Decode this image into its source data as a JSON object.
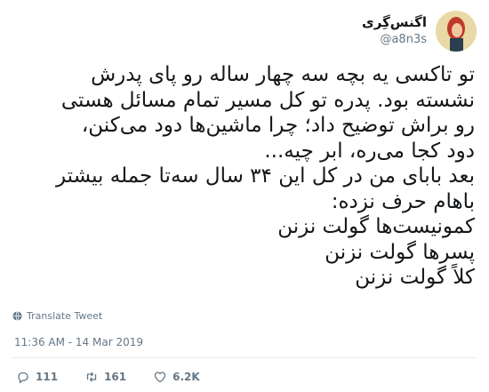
{
  "author": {
    "display_name": "اگنس‌گِری",
    "handle": "@a8n3s"
  },
  "tweet": {
    "lines": [
      "تو تاکسی یه بچه سه چهار ساله رو پای پدرش",
      "نشسته بود. پدره تو کل مسیر تمام مسائل هستی",
      "رو براش توضیح داد؛ چرا ماشین‌ها دود می‌کنن،",
      "دود کجا می‌ره، ابر چیه...",
      "بعد بابای من در کل این ۳۴ سال سه‌تا جمله بیشتر",
      "باهام حرف نزده:",
      "کمونیست‌ها گولت نزنن",
      "پسرها گولت نزنن",
      "کلاً گولت نزنن"
    ],
    "translate_label": "Translate Tweet",
    "timestamp": "11:36 AM - 14 Mar 2019"
  },
  "actions": {
    "reply_count": "111",
    "retweet_count": "161",
    "like_count": "6.2K"
  },
  "colors": {
    "text": "#14171a",
    "muted": "#657786",
    "divider": "#e6ecf0"
  }
}
